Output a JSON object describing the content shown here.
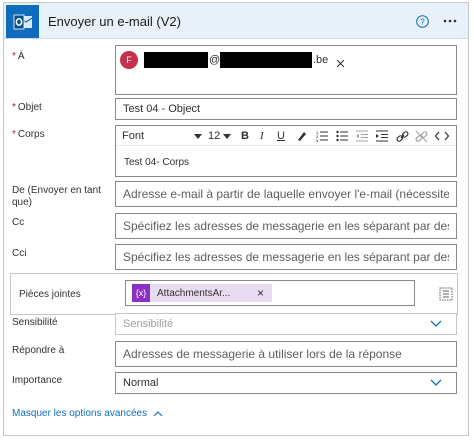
{
  "header": {
    "title": "Envoyer un e-mail (V2)",
    "app_icon": "outlook-icon",
    "help_icon": "question-icon",
    "more_icon": "ellipsis-icon"
  },
  "fields": {
    "to": {
      "label": "À",
      "avatar_initial": "F",
      "at_sign": "@",
      "domain_tail": ".be",
      "remove_icon": "close-icon"
    },
    "subject": {
      "label": "Objet",
      "value": "Test 04 - Object"
    },
    "body": {
      "label": "Corps",
      "font_label": "Font",
      "size_label": "12",
      "content": "Test 04- Corps"
    },
    "from": {
      "label": "De (Envoyer en tant que)",
      "placeholder": "Adresse e-mail à partir de laquelle envoyer l'e-mail (nécessite « Envoyer en tant que » ou « Envoyer de la part de »)"
    },
    "cc": {
      "label": "Cc",
      "placeholder": "Spécifiez les adresses de messagerie en les séparant par des points-virgules, comme quelqu'un@contoso.com"
    },
    "bcc": {
      "label": "Cci",
      "placeholder": "Spécifiez les adresses de messagerie en les séparant par des points-virgules, comme quelqu'un@contoso.com"
    },
    "attachments": {
      "label": "Pièces jointes",
      "token_icon": "{x}",
      "token_label": "AttachmentsAr...",
      "remove_label": "×"
    },
    "sensitivity": {
      "label": "Sensibilité",
      "placeholder": "Sensibilité"
    },
    "reply_to": {
      "label": "Répondre à",
      "placeholder": "Adresses de messagerie à utiliser lors de la réponse"
    },
    "importance": {
      "label": "Importance",
      "value": "Normal"
    }
  },
  "footer": {
    "hide_advanced_label": "Masquer les options avancées"
  },
  "colors": {
    "accent": "#0f6cbd",
    "required": "#a4262c",
    "token": "#8b2fc9",
    "avatar": "#c4314b"
  }
}
